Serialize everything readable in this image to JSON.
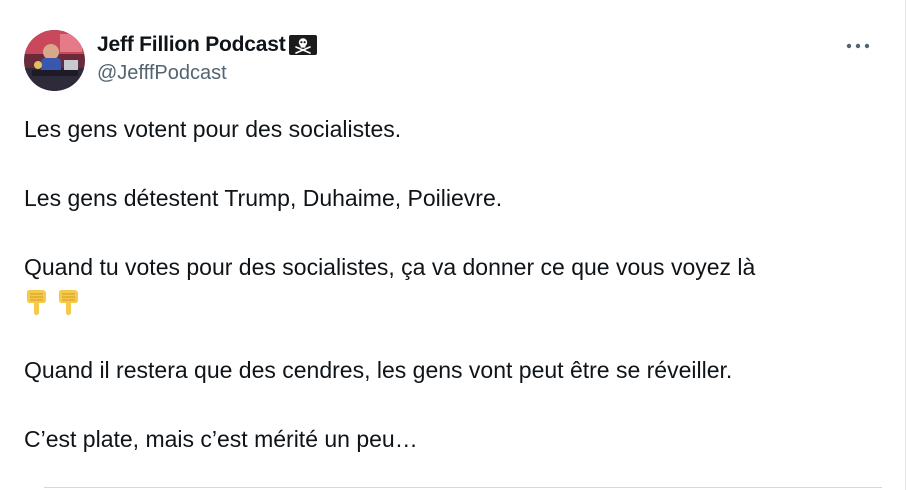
{
  "author": {
    "display_name": "Jeff Fillion Podcast",
    "handle": "@JefffPodcast",
    "badge_icon": "pirate-flag-icon"
  },
  "menu": {
    "icon": "more-horizontal-icon"
  },
  "tweet": {
    "paragraphs": [
      "Les gens votent pour des socialistes.",
      "Les gens détestent Trump, Duhaime, Poilievre.",
      "Quand tu votes pour des socialistes, ça va donner ce que vous voyez là",
      "Quand il restera que des cendres, les gens vont peut être se réveiller.",
      "C’est plate, mais c’est mérité un peu…"
    ],
    "emojis": [
      "pointing-down-emoji",
      "pointing-down-emoji"
    ]
  },
  "colors": {
    "text": "#0f1419",
    "secondary": "#536471",
    "divider": "#cfd9de",
    "emoji": "#f7c948"
  }
}
